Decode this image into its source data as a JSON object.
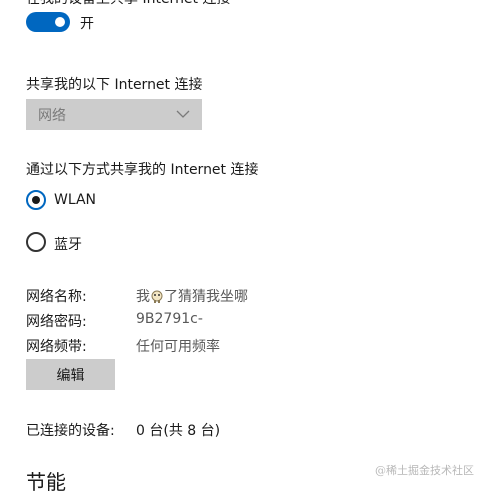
{
  "clipped_heading": "在我的设备上共享 Internet 连接",
  "sharing_toggle": {
    "state": "on",
    "label": "开"
  },
  "share_from": {
    "label": "共享我的以下 Internet 连接",
    "dropdown_value": "网络"
  },
  "share_over": {
    "label": "通过以下方式共享我的 Internet 连接",
    "options": [
      {
        "label": "WLAN",
        "selected": true
      },
      {
        "label": "蓝牙",
        "selected": false
      }
    ]
  },
  "network_info": {
    "name_label": "网络名称:",
    "name_prefix": "我",
    "name_suffix": "了猜猜我坐哪",
    "password_label": "网络密码:",
    "password_value": "9B2791c-",
    "band_label": "网络频带:",
    "band_value": "任何可用频率"
  },
  "edit_button": "编辑",
  "connected_devices": {
    "label": "已连接的设备:",
    "value": "0 台(共 8 台)"
  },
  "next_section_heading": "节能",
  "watermark": "@稀土掘金技术社区",
  "colors": {
    "accent": "#0067c0",
    "control_bg": "#cccccc",
    "disabled_text": "#7a7a7a"
  }
}
